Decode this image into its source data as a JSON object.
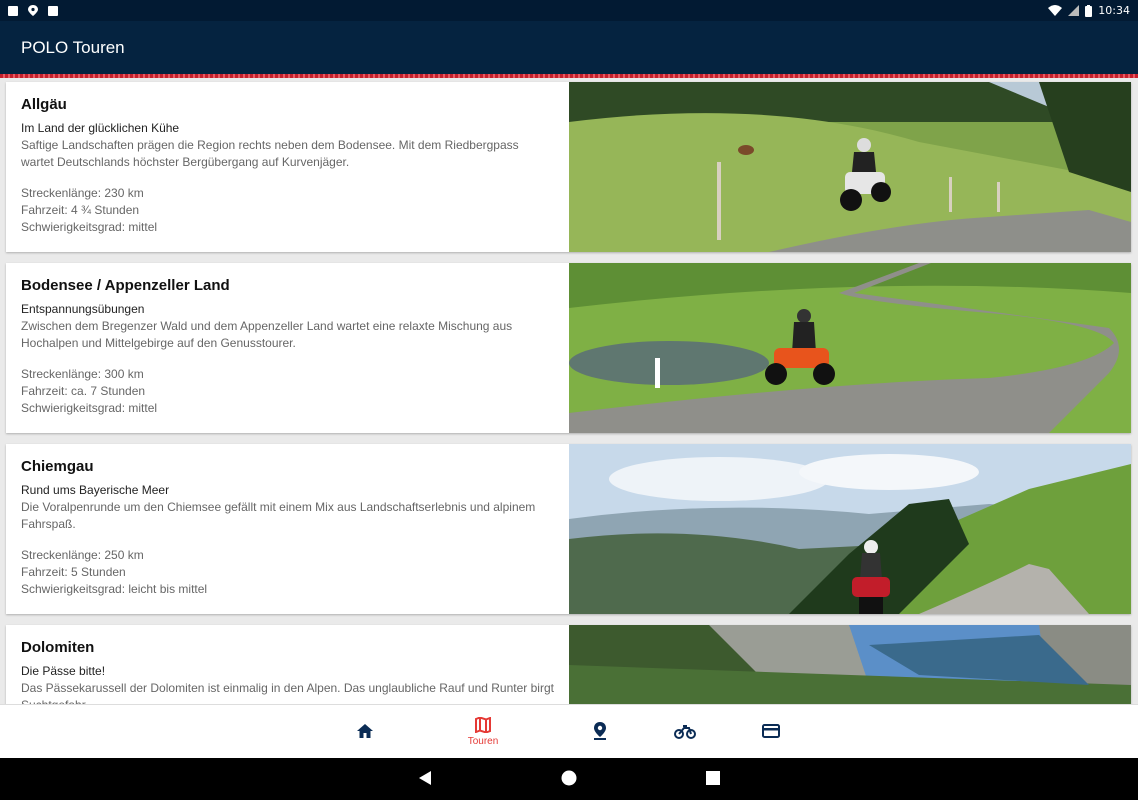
{
  "status_bar": {
    "time": "10:34"
  },
  "app_bar": {
    "title": "POLO Touren"
  },
  "tours": [
    {
      "title": "Allgäu",
      "subtitle": "Im Land der glücklichen Kühe",
      "description": "Saftige Landschaften prägen die Region rechts neben dem Bodensee. Mit dem Riedbergpass wartet Deutschlands höchster Bergübergang auf Kurvenjäger.",
      "length": "Streckenlänge:  230 km",
      "duration": "Fahrzeit: 4 ¾  Stunden",
      "difficulty": "Schwierigkeitsgrad: mittel"
    },
    {
      "title": "Bodensee / Appenzeller Land",
      "subtitle": "Entspannungsübungen",
      "description": "Zwischen dem Bregenzer Wald und dem Appenzeller Land wartet eine relaxte Mischung aus Hochalpen und Mittelgebirge auf den Genusstourer.",
      "length": "Streckenlänge: 300 km",
      "duration": "Fahrzeit: ca. 7 Stunden",
      "difficulty": "Schwierigkeitsgrad: mittel"
    },
    {
      "title": "Chiemgau",
      "subtitle": "Rund ums Bayerische Meer",
      "description": "Die Voralpenrunde um den Chiemsee gefällt mit einem Mix aus Landschaftserlebnis und alpinem Fahrspaß.",
      "length": "Streckenlänge: 250 km",
      "duration": "Fahrzeit: 5 Stunden",
      "difficulty": "Schwierigkeitsgrad: leicht bis mittel"
    },
    {
      "title": "Dolomiten",
      "subtitle": "Die Pässe bitte!",
      "description": "Das Pässekarussell der Dolomiten ist einmalig in den Alpen. Das unglaubliche Rauf und Runter birgt Suchtgefahr.",
      "length": "",
      "duration": "",
      "difficulty": ""
    }
  ],
  "bottom_nav": {
    "items": [
      {
        "icon": "home-icon",
        "label": ""
      },
      {
        "icon": "map-icon",
        "label": "Touren"
      },
      {
        "icon": "location-pin-icon",
        "label": ""
      },
      {
        "icon": "motorcycle-icon",
        "label": ""
      },
      {
        "icon": "card-icon",
        "label": ""
      }
    ]
  },
  "colors": {
    "app_bar": "#052340",
    "accent": "#e53935",
    "nav_icon": "#0b2c55"
  }
}
